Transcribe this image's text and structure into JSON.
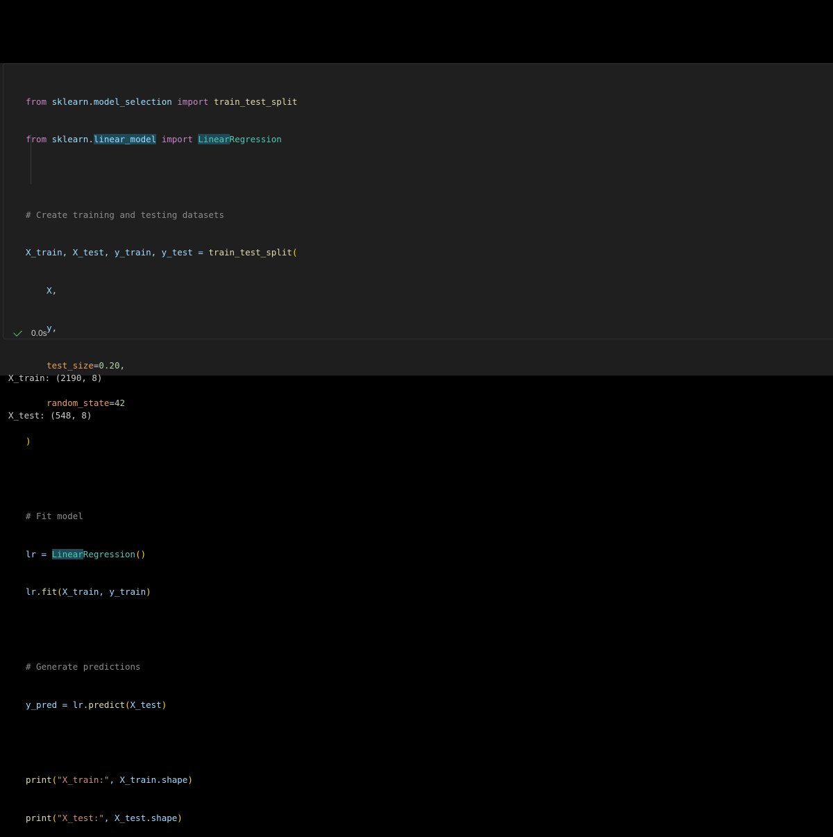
{
  "cell": {
    "code": {
      "l1": {
        "kw1": "from",
        "mod_a": "sklearn",
        "dot": ".",
        "mod_b": "model_selection",
        "kw2": "import",
        "name": "train_test_split"
      },
      "l2": {
        "kw1": "from",
        "mod_a": "sklearn",
        "dot": ".",
        "mod_b": "linear_model",
        "kw2": "import",
        "cls_a": "Linear",
        "cls_b": "Regression"
      },
      "l4": {
        "comment": "# Create training and testing datasets"
      },
      "l5": {
        "lhs": "X_train, X_test, y_train, y_test = ",
        "fn": "train_test_split",
        "paren": "("
      },
      "l6": {
        "arg": "X",
        "comma": ","
      },
      "l7": {
        "arg": "y,"
      },
      "l8": {
        "param": "test_size",
        "eq": "=",
        "val": "0.20",
        "comma": ","
      },
      "l9": {
        "param": "random_state",
        "eq": "=",
        "val": "42"
      },
      "l10": {
        "paren": ")"
      },
      "l12": {
        "comment": "# Fit model"
      },
      "l13": {
        "lhs": "lr = ",
        "cls_a": "Linear",
        "cls_b": "Regression",
        "paren": "()"
      },
      "l14": {
        "obj": "lr",
        "dot": ".",
        "fn": "fit",
        "open": "(",
        "args": "X_train, y_train",
        "close": ")"
      },
      "l16": {
        "comment": "# Generate predictions"
      },
      "l17": {
        "lhs": "y_pred = lr.",
        "fn": "predict",
        "open": "(",
        "args": "X_test",
        "close": ")"
      },
      "l19": {
        "fn": "print",
        "open": "(",
        "str": "\"X_train:\"",
        "args": ", X_train.shape",
        "close": ")"
      },
      "l20": {
        "fn": "print",
        "open": "(",
        "str": "\"X_test:\"",
        "args": ", X_test.shape",
        "close": ")"
      }
    },
    "status": {
      "icon": "check-icon",
      "time": "0.0s"
    }
  },
  "output": {
    "lines": [
      "X_train: (2190, 8)",
      "X_test: (548, 8)"
    ]
  },
  "colors": {
    "background": "#000000",
    "cell_background": "#1f1f1f",
    "success": "#4ec97a"
  }
}
